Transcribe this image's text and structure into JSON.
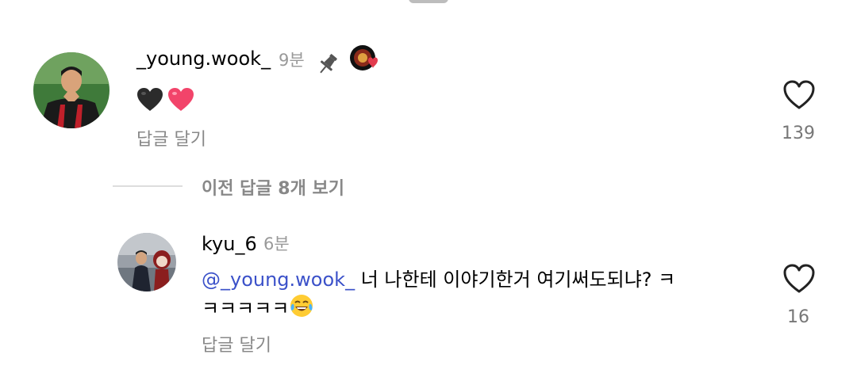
{
  "comments": [
    {
      "username": "_young.wook_",
      "time": "9분",
      "text": "",
      "emojis": [
        "black-heart",
        "pink-heart"
      ],
      "reply_label": "답글 달기",
      "like_count": "139",
      "pinned": true,
      "badge": "team-badge"
    },
    {
      "username": "kyu_6",
      "time": "6분",
      "mention": "@_young.wook_",
      "text_line1": " 너 나한테 이야기한거 여기써도되냐? ㅋ",
      "text_line2": "ㅋㅋㅋㅋㅋ",
      "emojis": [
        "tears-of-joy"
      ],
      "reply_label": "답글 달기",
      "like_count": "16"
    }
  ],
  "view_previous_label": "이전 답글 8개 보기",
  "colors": {
    "mention": "#3b51c9",
    "secondary_text": "#888888",
    "divider": "#dddddd"
  }
}
